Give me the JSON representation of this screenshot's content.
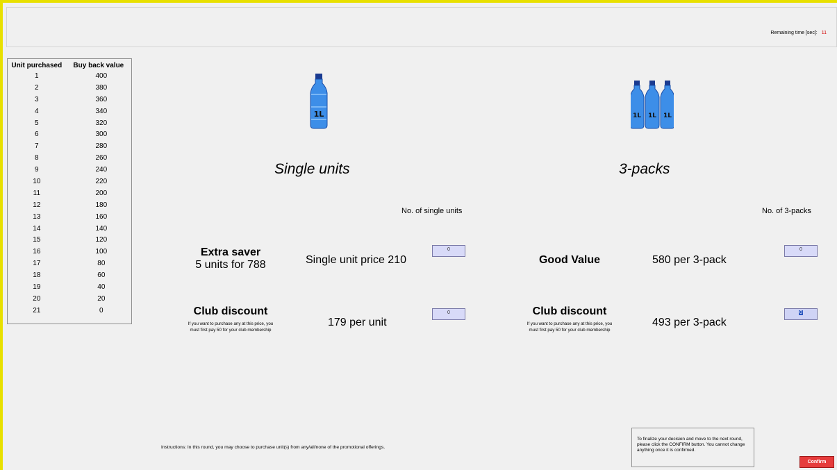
{
  "header": {
    "timer_label": "Remaining time [sec]:",
    "timer_value": "11",
    "timer_color": "#d40000"
  },
  "buyback_table": {
    "headers": [
      "Unit purchased",
      "Buy back value"
    ],
    "rows": [
      [
        "1",
        "400"
      ],
      [
        "2",
        "380"
      ],
      [
        "3",
        "360"
      ],
      [
        "4",
        "340"
      ],
      [
        "5",
        "320"
      ],
      [
        "6",
        "300"
      ],
      [
        "7",
        "280"
      ],
      [
        "8",
        "260"
      ],
      [
        "9",
        "240"
      ],
      [
        "10",
        "220"
      ],
      [
        "11",
        "200"
      ],
      [
        "12",
        "180"
      ],
      [
        "13",
        "160"
      ],
      [
        "14",
        "140"
      ],
      [
        "15",
        "120"
      ],
      [
        "16",
        "100"
      ],
      [
        "17",
        "80"
      ],
      [
        "18",
        "60"
      ],
      [
        "19",
        "40"
      ],
      [
        "20",
        "20"
      ],
      [
        "21",
        "0"
      ]
    ]
  },
  "single": {
    "bottle_label": "1L",
    "title": "Single units",
    "count_label": "No. of single units",
    "extra_saver_title": "Extra saver",
    "extra_saver_sub": "5 units for 788",
    "unit_price": "Single unit price 210",
    "unit_qty": "0",
    "club_title": "Club discount",
    "club_note_1": "If you want to purchase any at this price, you",
    "club_note_2": "must first pay 50 for your club membership",
    "club_price": "179 per unit",
    "club_qty": "0"
  },
  "pack": {
    "bottle_label": "1L",
    "title": "3-packs",
    "count_label": "No. of 3-packs",
    "good_value_title": "Good Value",
    "good_value_price": "580 per 3-pack",
    "good_value_qty": "0",
    "club_title": "Club discount",
    "club_note_1": "If you want to purchase any at this price, you",
    "club_note_2": "must first pay 50 for your club membership",
    "club_price": "493 per 3-pack",
    "club_qty": "0"
  },
  "footer": {
    "instructions": "Instructions: In this round, you may choose to purchase unit(s) from any/all/none of the promotional offerings.",
    "finalize_text": "To finalize your decision and move to the next round, please click the CONFIRM button. You cannot change anything once it is confirmed.",
    "confirm_label": "Confirm",
    "confirm_color": "#e63c3c"
  }
}
